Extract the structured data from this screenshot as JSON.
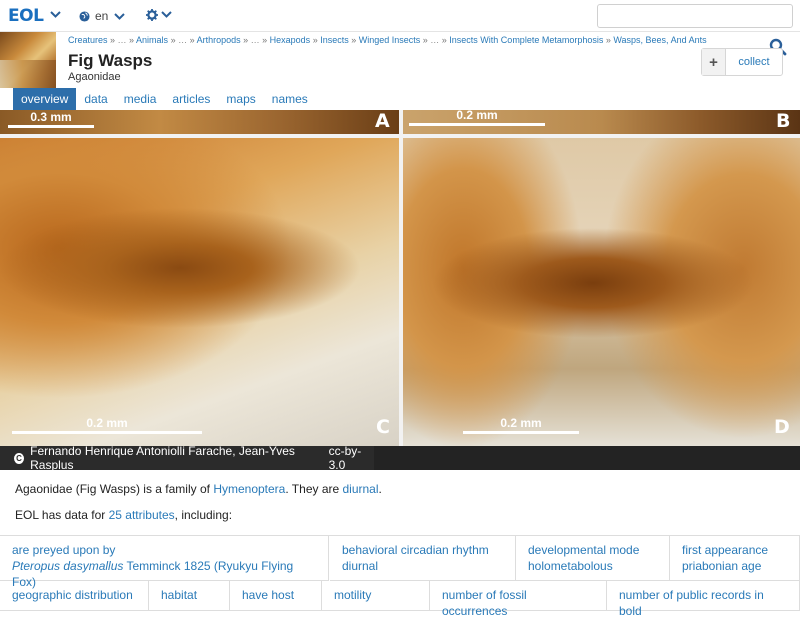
{
  "topbar": {
    "logo": "EOL",
    "language": "en",
    "search_placeholder": ""
  },
  "header": {
    "breadcrumbs": [
      {
        "label": "Creatures",
        "link": true
      },
      {
        "label": "…",
        "link": false
      },
      {
        "label": "Animals",
        "link": true
      },
      {
        "label": "…",
        "link": false
      },
      {
        "label": "Arthropods",
        "link": true
      },
      {
        "label": "…",
        "link": false
      },
      {
        "label": "Hexapods",
        "link": true
      },
      {
        "label": "Insects",
        "link": true
      },
      {
        "label": "Winged Insects",
        "link": true
      },
      {
        "label": "…",
        "link": false
      },
      {
        "label": "Insects With Complete Metamorphosis",
        "link": true
      },
      {
        "label": "Wasps, Bees, And Ants",
        "link": true
      },
      {
        "label": "…",
        "link": false
      }
    ],
    "title": "Fig Wasps",
    "subtitle": "Agaonidae",
    "collect_label": "collect",
    "collect_plus": "+"
  },
  "tabs": [
    {
      "label": "overview",
      "active": true
    },
    {
      "label": "data",
      "active": false
    },
    {
      "label": "media",
      "active": false
    },
    {
      "label": "articles",
      "active": false
    },
    {
      "label": "maps",
      "active": false
    },
    {
      "label": "names",
      "active": false
    }
  ],
  "image": {
    "panels": [
      {
        "letter": "A",
        "scale": "0.3 mm"
      },
      {
        "letter": "B",
        "scale": "0.2 mm"
      },
      {
        "letter": "C",
        "scale": "0.2 mm"
      },
      {
        "letter": "D",
        "scale": "0.2 mm"
      }
    ],
    "attribution": "Fernando Henrique Antoniolli Farache, Jean-Yves Rasplus",
    "license": "cc-by-3.0",
    "cc_symbol": "C"
  },
  "summary": {
    "prefix": "Agaonidae (Fig Wasps) is a family of ",
    "link1": "Hymenoptera",
    "middle": ". They are ",
    "link2": "diurnal",
    "suffix": "."
  },
  "summary2": {
    "prefix": "EOL has data for ",
    "link": "25 attributes",
    "suffix": ", including:"
  },
  "attributes_row1": [
    {
      "name": "are preyed upon by",
      "value_italic": "Pteropus dasymallus",
      "value_rest": " Temminck 1825 (Ryukyu Flying Fox)"
    },
    {
      "name": "behavioral circadian rhythm",
      "value_italic": "",
      "value_rest": "diurnal"
    },
    {
      "name": "developmental mode",
      "value_italic": "",
      "value_rest": "holometabolous"
    },
    {
      "name": "first appearance",
      "value_italic": "",
      "value_rest": "priabonian age"
    }
  ],
  "attributes_row2": [
    {
      "name": "geographic distribution"
    },
    {
      "name": "habitat"
    },
    {
      "name": "have host"
    },
    {
      "name": "motility"
    },
    {
      "name": "number of fossil occurrences"
    },
    {
      "name": "number of public records in bold"
    }
  ]
}
